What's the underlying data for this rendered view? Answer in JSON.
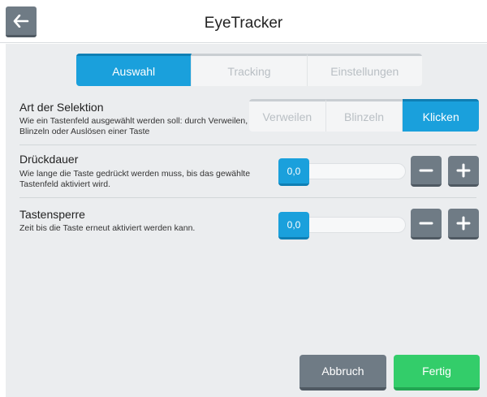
{
  "header": {
    "title": "EyeTracker",
    "back_icon": "arrow-left-icon"
  },
  "tabs": [
    {
      "label": "Auswahl",
      "active": true
    },
    {
      "label": "Tracking",
      "active": false
    },
    {
      "label": "Einstellungen",
      "active": false
    }
  ],
  "selection": {
    "title": "Art der Selektion",
    "description": "Wie ein Tastenfeld ausgewählt werden soll: durch Verweilen, Blinzeln oder Auslösen einer Taste",
    "options": [
      {
        "label": "Verweilen",
        "active": false
      },
      {
        "label": "Blinzeln",
        "active": false
      },
      {
        "label": "Klicken",
        "active": true
      }
    ]
  },
  "press_duration": {
    "title": "Drückdauer",
    "description": "Wie lange die Taste gedrückt werden muss, bis das gewählte Tastenfeld aktiviert wird.",
    "value": "0,0"
  },
  "key_lock": {
    "title": "Tastensperre",
    "description": "Zeit bis die Taste erneut aktiviert werden kann.",
    "value": "0,0"
  },
  "footer": {
    "cancel_label": "Abbruch",
    "done_label": "Fertig"
  },
  "colors": {
    "accent": "#1aa0dc",
    "neutral_button": "#6f7b85",
    "success": "#33cd6a",
    "panel_bg": "#ebedef"
  }
}
